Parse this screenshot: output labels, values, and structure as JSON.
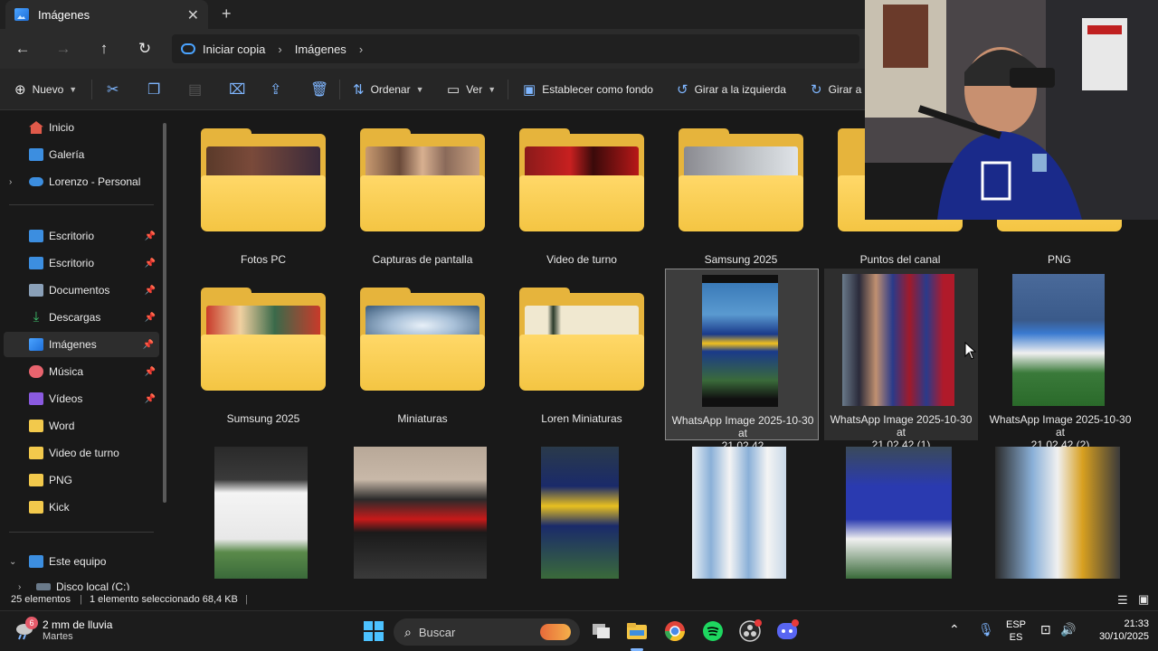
{
  "window": {
    "tab_title": "Imágenes",
    "tab_close": "✕",
    "new_tab": "+"
  },
  "addressbar": {
    "back": "←",
    "forward": "→",
    "up": "↑",
    "refresh": "↻",
    "crumbs": [
      "Iniciar copia",
      "Imágenes"
    ],
    "chevron": "›"
  },
  "commandbar": {
    "new_label": "Nuevo",
    "sort_label": "Ordenar",
    "view_label": "Ver",
    "set_background": "Establecer como fondo",
    "rotate_left": "Girar a la izquierda",
    "rotate_right": "Girar a la"
  },
  "sidebar": {
    "top": [
      {
        "label": "Inicio"
      },
      {
        "label": "Galería"
      },
      {
        "label": "Lorenzo - Personal"
      }
    ],
    "pinned": [
      {
        "label": "Escritorio",
        "pinned": true
      },
      {
        "label": "Escritorio",
        "pinned": true
      },
      {
        "label": "Documentos",
        "pinned": true
      },
      {
        "label": "Descargas",
        "pinned": true
      },
      {
        "label": "Imágenes",
        "pinned": true,
        "selected": true
      },
      {
        "label": "Música",
        "pinned": true
      },
      {
        "label": "Vídeos",
        "pinned": true
      },
      {
        "label": "Word"
      },
      {
        "label": "Video de turno"
      },
      {
        "label": "PNG"
      },
      {
        "label": "Kick"
      }
    ],
    "this_pc": "Este equipo",
    "local_disk": "Disco local (C:)"
  },
  "content": {
    "row1": [
      {
        "name": "Fotos PC",
        "type": "folder"
      },
      {
        "name": "Capturas de pantalla",
        "type": "folder"
      },
      {
        "name": "Video de turno",
        "type": "folder"
      },
      {
        "name": "Samsung 2025",
        "type": "folder"
      },
      {
        "name": "Puntos del canal",
        "type": "folder"
      },
      {
        "name": "PNG",
        "type": "folder"
      }
    ],
    "row2": [
      {
        "name": "Sumsung 2025",
        "type": "folder"
      },
      {
        "name": "Miniaturas",
        "type": "folder"
      },
      {
        "name": "Loren Miniaturas",
        "type": "folder"
      },
      {
        "name_line1": "WhatsApp Image 2025-10-30 at",
        "name_line2": "21.02.42",
        "type": "image",
        "selected": true
      },
      {
        "name_line1": "WhatsApp Image 2025-10-30 at",
        "name_line2": "21.02.42 (1)",
        "type": "image",
        "hover": true
      },
      {
        "name_line1": "WhatsApp Image 2025-10-30 at",
        "name_line2": "21.02.42 (2)",
        "type": "image"
      }
    ]
  },
  "statusbar": {
    "count": "25 elementos",
    "selection": "1 elemento seleccionado  68,4 KB"
  },
  "taskbar": {
    "weather_badge": "6",
    "weather_line1": "2 mm de lluvia",
    "weather_line2": "Martes",
    "search_placeholder": "Buscar",
    "lang_line1": "ESP",
    "lang_line2": "ES",
    "time": "21:33",
    "date": "30/10/2025"
  },
  "colors": {
    "accent": "#7fb6ff",
    "folder": "#f4c543",
    "background": "#191919"
  }
}
